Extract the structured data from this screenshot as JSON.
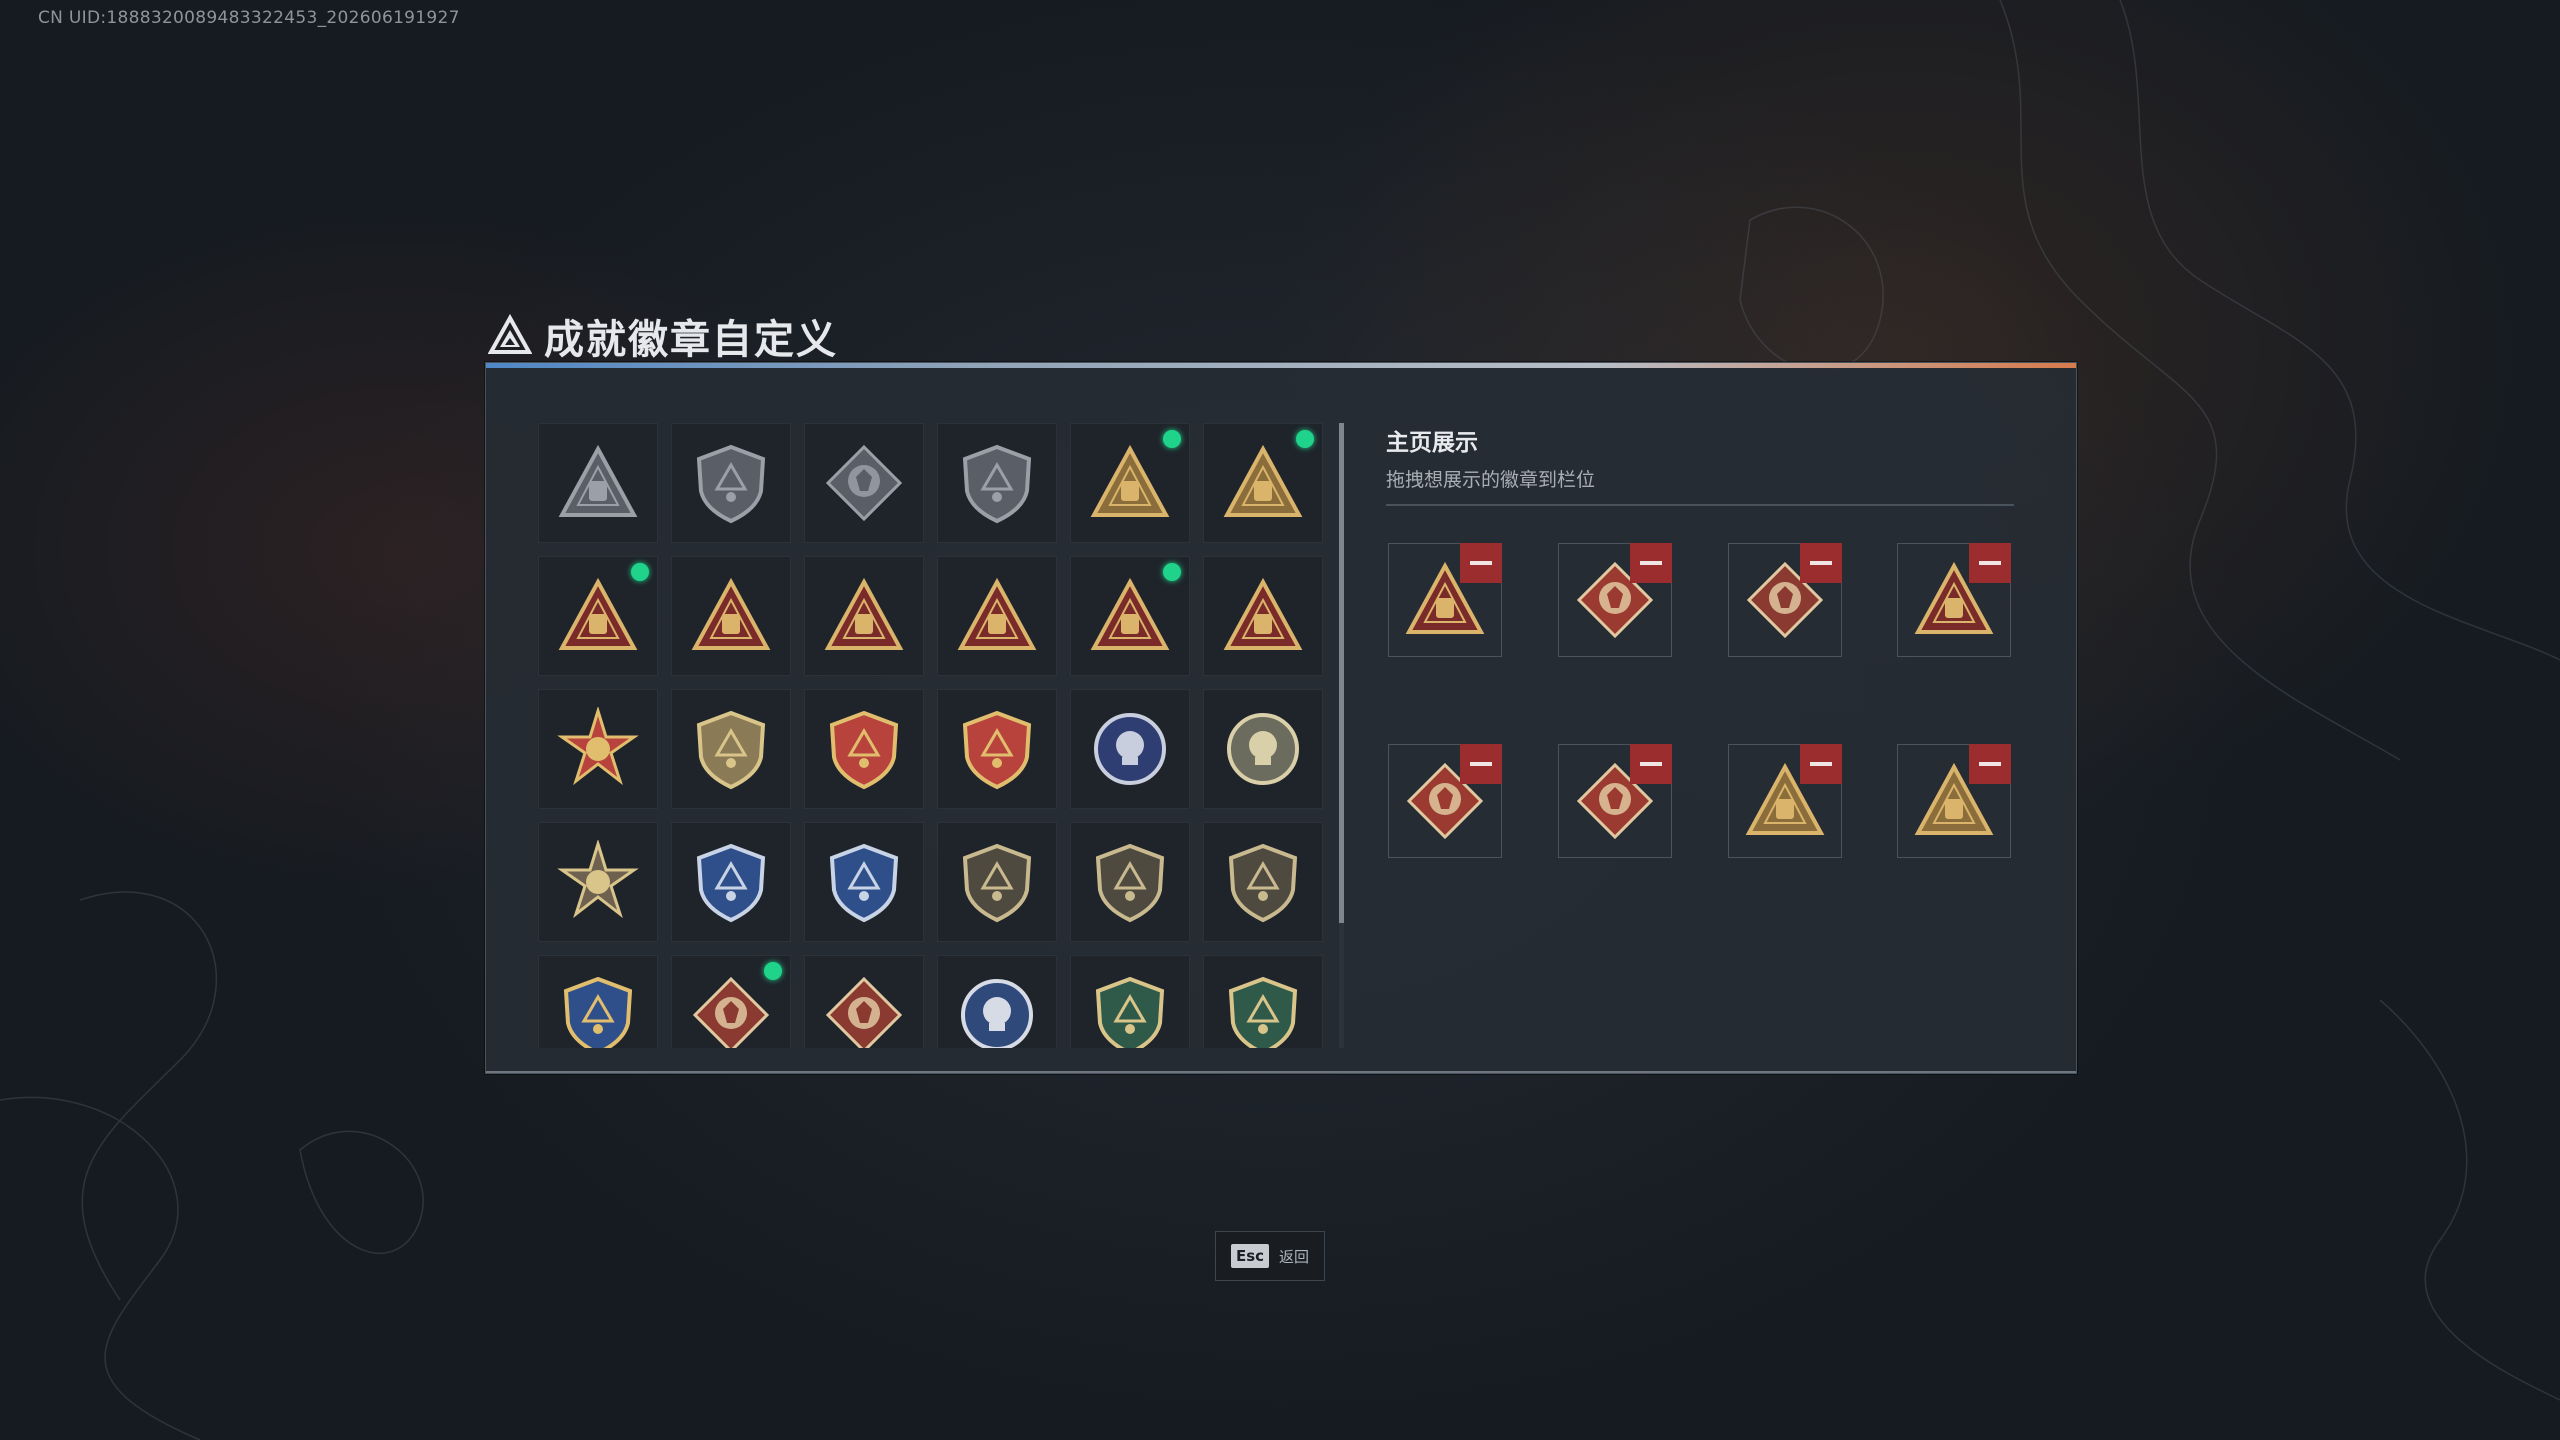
{
  "uid": "CN UID:1888320089483322453_202606191927",
  "title": "成就徽章自定义",
  "grid": {
    "badges": [
      {
        "icon": "triangle-shield-badge-icon",
        "fill": "#5a5e66",
        "accent": "#9aa0a8",
        "dot": false
      },
      {
        "icon": "helicopter-shield-badge-icon",
        "fill": "#5a5e66",
        "accent": "#9aa0a8",
        "dot": false
      },
      {
        "icon": "diamond-shield-badge-icon",
        "fill": "#5a5e66",
        "accent": "#9aa0a8",
        "dot": false
      },
      {
        "icon": "arrow-shield-badge-icon",
        "fill": "#5a5e66",
        "accent": "#9aa0a8",
        "dot": false
      },
      {
        "icon": "s4-gold-triangle-badge-icon",
        "fill": "#8a6d3a",
        "accent": "#d9b46a",
        "dot": true
      },
      {
        "icon": "s5-gold-triangle-badge-icon",
        "fill": "#8a6d3a",
        "accent": "#d9b46a",
        "dot": true
      },
      {
        "icon": "s6-red-triangle-badge-icon",
        "fill": "#7a2a28",
        "accent": "#d9b46a",
        "dot": true
      },
      {
        "icon": "s1-red-triangle-badge-icon",
        "fill": "#7a2a28",
        "accent": "#d9b46a",
        "dot": false
      },
      {
        "icon": "helmet-red-triangle-badge-icon",
        "fill": "#7a2a28",
        "accent": "#d9b46a",
        "dot": false
      },
      {
        "icon": "number-one-triangle-badge-icon",
        "fill": "#7a2a28",
        "accent": "#d9b46a",
        "dot": false
      },
      {
        "icon": "bottle-red-triangle-badge-icon",
        "fill": "#7a2a28",
        "accent": "#d9b46a",
        "dot": true
      },
      {
        "icon": "soldier-red-triangle-badge-icon",
        "fill": "#7a2a28",
        "accent": "#d9b46a",
        "dot": false
      },
      {
        "icon": "star-emblem-badge-icon",
        "fill": "#b8433c",
        "accent": "#e0be6e",
        "dot": false
      },
      {
        "icon": "gold-shield-badge-icon",
        "fill": "#8a7a55",
        "accent": "#d9c48a",
        "dot": false
      },
      {
        "icon": "winged-shield-badge-icon",
        "fill": "#b8433c",
        "accent": "#e0be6e",
        "dot": false
      },
      {
        "icon": "star-shield-badge-icon",
        "fill": "#b8433c",
        "accent": "#e0be6e",
        "dot": false
      },
      {
        "icon": "skull-blue-badge-icon",
        "fill": "#2f3e72",
        "accent": "#c8cede",
        "dot": false
      },
      {
        "icon": "skull-round-badge-icon",
        "fill": "#6b6b5e",
        "accent": "#d9cfa8",
        "dot": false
      },
      {
        "icon": "tank-sunburst-badge-icon",
        "fill": "#6e6150",
        "accent": "#d9c48a",
        "dot": false
      },
      {
        "icon": "blue-crosshair-badge-icon",
        "fill": "#2f4f8a",
        "accent": "#c8d4e6",
        "dot": false
      },
      {
        "icon": "blue-crosshair-badge-2-icon",
        "fill": "#2f4f8a",
        "accent": "#c8d4e6",
        "dot": false
      },
      {
        "icon": "rifle-shield-badge-icon",
        "fill": "#4f4a40",
        "accent": "#c9b98f",
        "dot": false
      },
      {
        "icon": "rifle-shield-badge-2-icon",
        "fill": "#4f4a40",
        "accent": "#c9b98f",
        "dot": false
      },
      {
        "icon": "rifle-shield-badge-3-icon",
        "fill": "#4f4a40",
        "accent": "#c9b98f",
        "dot": false
      },
      {
        "icon": "gold-sword-shield-badge-icon",
        "fill": "#2f4f8a",
        "accent": "#e0be6e",
        "dot": false
      },
      {
        "icon": "wolf-diamond-badge-icon",
        "fill": "#8a3a30",
        "accent": "#e0c8a0",
        "dot": true
      },
      {
        "icon": "wolf-diamond-badge-2-icon",
        "fill": "#8a3a30",
        "accent": "#e0c8a0",
        "dot": false
      },
      {
        "icon": "eagle-round-badge-icon",
        "fill": "#2f4a7a",
        "accent": "#d6dbe6",
        "dot": false
      },
      {
        "icon": "wasp-green-badge-icon",
        "fill": "#2f5a4a",
        "accent": "#d9c48a",
        "dot": false
      },
      {
        "icon": "gun-green-badge-icon",
        "fill": "#2f5a4a",
        "accent": "#d9c48a",
        "dot": false
      }
    ]
  },
  "showcase": {
    "title": "主页展示",
    "subtitle": "拖拽想展示的徽章到栏位",
    "slots": [
      {
        "icon": "bottle-red-triangle-badge-icon",
        "fill": "#7a2a28",
        "accent": "#d9b46a",
        "shape": "triangle"
      },
      {
        "icon": "backpack-red-diamond-badge-icon",
        "fill": "#9a3a30",
        "accent": "#e0c8a0",
        "shape": "diamond"
      },
      {
        "icon": "wolf-diamond-badge-icon",
        "fill": "#8a3a30",
        "accent": "#e0c8a0",
        "shape": "diamond"
      },
      {
        "icon": "s6-red-triangle-badge-icon",
        "fill": "#7a2a28",
        "accent": "#d9b46a",
        "shape": "triangle"
      },
      {
        "icon": "fist-red-diamond-badge-icon",
        "fill": "#9a3a30",
        "accent": "#e0c8a0",
        "shape": "diamond"
      },
      {
        "icon": "runner-red-diamond-badge-icon",
        "fill": "#9a3a30",
        "accent": "#e0c8a0",
        "shape": "diamond"
      },
      {
        "icon": "s4-gold-triangle-badge-icon",
        "fill": "#8a6d3a",
        "accent": "#d9b46a",
        "shape": "triangle"
      },
      {
        "icon": "s5-gold-triangle-badge-icon",
        "fill": "#8a6d3a",
        "accent": "#d9b46a",
        "shape": "triangle"
      }
    ]
  },
  "footer": {
    "esc_key": "Esc",
    "esc_label": "返回"
  }
}
